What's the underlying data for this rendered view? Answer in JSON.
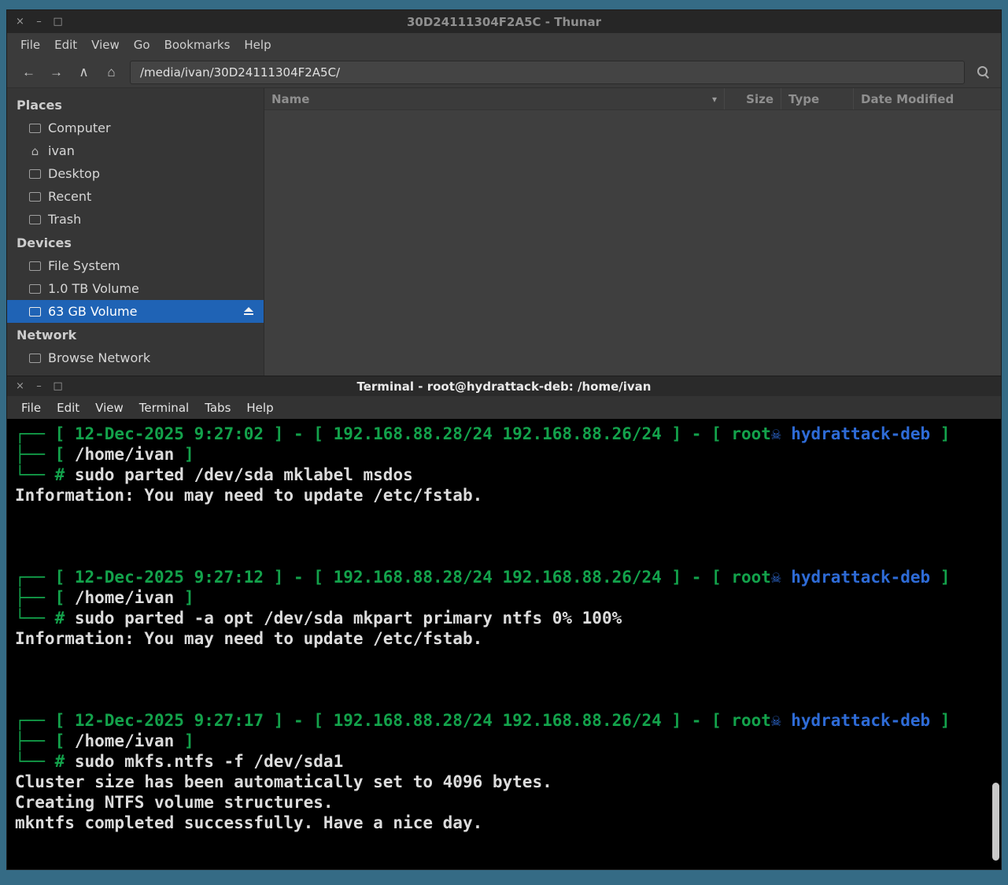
{
  "desktop": {
    "background": "#356b85"
  },
  "thunar": {
    "title": "30D24111304F2A5C - Thunar",
    "window_buttons": {
      "close": "×",
      "minimize": "–",
      "maximize": "□"
    },
    "menu": [
      "File",
      "Edit",
      "View",
      "Go",
      "Bookmarks",
      "Help"
    ],
    "toolbar": {
      "path": "/media/ivan/30D24111304F2A5C/",
      "icons": {
        "back": "←",
        "forward": "→",
        "up": "∧",
        "home": "⌂"
      }
    },
    "sidebar": {
      "sections": [
        {
          "label": "Places",
          "items": [
            {
              "label": "Computer",
              "icon": "computer-icon"
            },
            {
              "label": "ivan",
              "icon": "home-icon",
              "glyph": "⌂"
            },
            {
              "label": "Desktop",
              "icon": "desktop-icon"
            },
            {
              "label": "Recent",
              "icon": "recent-icon"
            },
            {
              "label": "Trash",
              "icon": "trash-icon"
            }
          ]
        },
        {
          "label": "Devices",
          "items": [
            {
              "label": "File System",
              "icon": "harddisk-icon"
            },
            {
              "label": "1.0 TB Volume",
              "icon": "harddisk-icon"
            },
            {
              "label": "63 GB Volume",
              "icon": "usb-drive-icon",
              "selected": true,
              "eject": true
            }
          ]
        },
        {
          "label": "Network",
          "items": [
            {
              "label": "Browse Network",
              "icon": "network-icon"
            }
          ]
        }
      ]
    },
    "list": {
      "columns": [
        "Name",
        "Size",
        "Type",
        "Date Modified"
      ],
      "sort_indicator": "▾",
      "rows": []
    }
  },
  "terminal": {
    "title": "Terminal - root@hydrattack-deb: /home/ivan",
    "window_buttons": {
      "close": "×",
      "minimize": "–",
      "maximize": "□"
    },
    "menu": [
      "File",
      "Edit",
      "View",
      "Terminal",
      "Tabs",
      "Help"
    ],
    "prompt_skull": "☠",
    "blocks": [
      {
        "timestamp": "12-Dec-2025 9:27:02",
        "interfaces": "192.168.88.28/24 192.168.88.26/24",
        "user": "root",
        "host": "hydrattack-deb",
        "cwd": "/home/ivan",
        "command": "sudo parted /dev/sda mklabel msdos",
        "output": [
          "Information: You may need to update /etc/fstab."
        ]
      },
      {
        "timestamp": "12-Dec-2025 9:27:12",
        "interfaces": "192.168.88.28/24 192.168.88.26/24",
        "user": "root",
        "host": "hydrattack-deb",
        "cwd": "/home/ivan",
        "command": "sudo parted -a opt /dev/sda mkpart primary ntfs 0% 100%",
        "output": [
          "Information: You may need to update /etc/fstab."
        ]
      },
      {
        "timestamp": "12-Dec-2025 9:27:17",
        "interfaces": "192.168.88.28/24 192.168.88.26/24",
        "user": "root",
        "host": "hydrattack-deb",
        "cwd": "/home/ivan",
        "command": "sudo mkfs.ntfs -f /dev/sda1",
        "output": [
          "Cluster size has been automatically set to 4096 bytes.",
          "Creating NTFS volume structures.",
          "mkntfs completed successfully. Have a nice day."
        ]
      }
    ],
    "colors": {
      "green": "#13a24b",
      "blue": "#2e6bd6",
      "white": "#dcdcdc",
      "background": "#000000"
    }
  }
}
